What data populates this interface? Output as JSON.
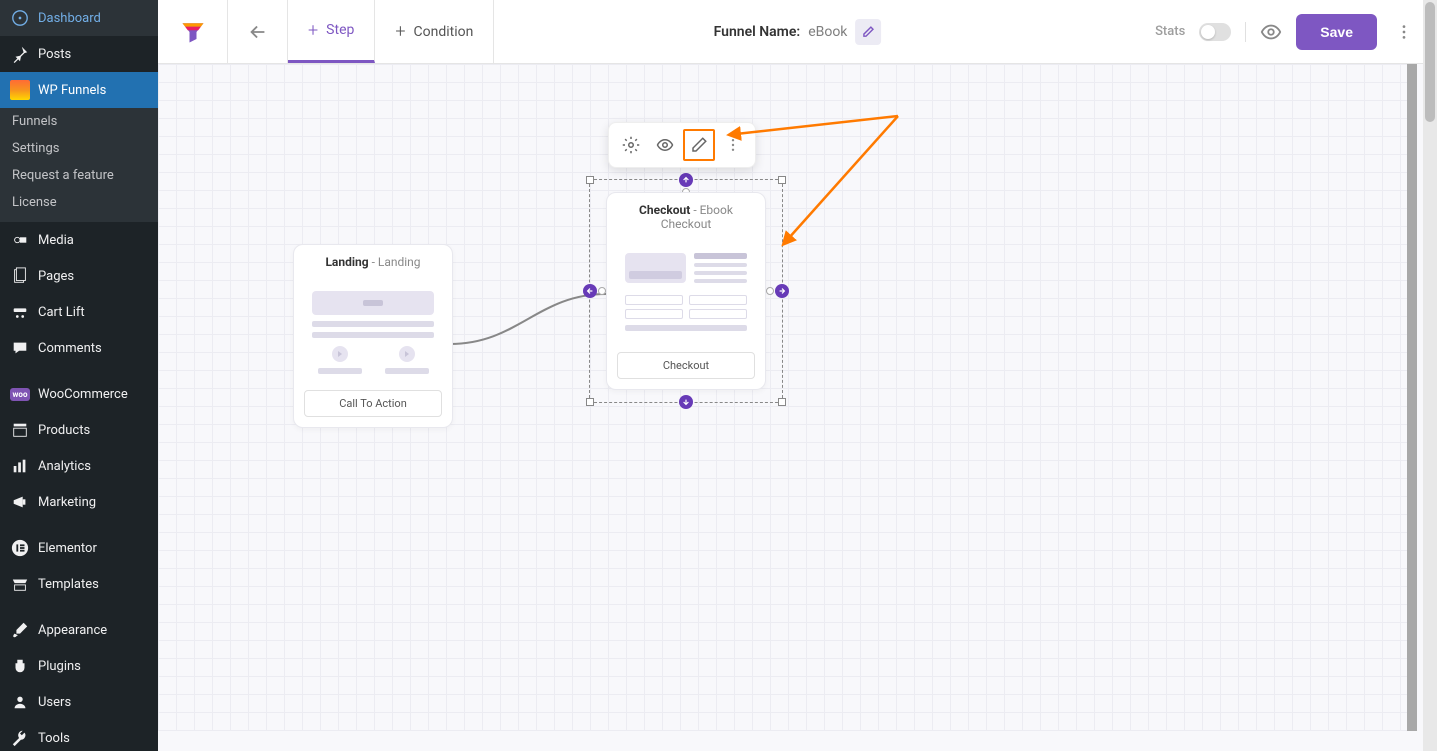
{
  "sidebar": {
    "items": [
      {
        "label": "Dashboard",
        "icon": "dashboard"
      },
      {
        "label": "Posts",
        "icon": "pin"
      },
      {
        "label": "WP Funnels",
        "icon": "wpf",
        "active": true
      },
      {
        "label": "Media",
        "icon": "media"
      },
      {
        "label": "Pages",
        "icon": "page"
      },
      {
        "label": "Cart Lift",
        "icon": "cart"
      },
      {
        "label": "Comments",
        "icon": "comment"
      },
      {
        "label": "WooCommerce",
        "icon": "woo"
      },
      {
        "label": "Products",
        "icon": "products"
      },
      {
        "label": "Analytics",
        "icon": "analytics"
      },
      {
        "label": "Marketing",
        "icon": "marketing"
      },
      {
        "label": "Elementor",
        "icon": "elementor"
      },
      {
        "label": "Templates",
        "icon": "templates"
      },
      {
        "label": "Appearance",
        "icon": "appearance"
      },
      {
        "label": "Plugins",
        "icon": "plugins"
      },
      {
        "label": "Users",
        "icon": "users"
      },
      {
        "label": "Tools",
        "icon": "tools"
      }
    ],
    "submenu": [
      "Funnels",
      "Settings",
      "Request a feature",
      "License"
    ]
  },
  "topbar": {
    "step_label": "Step",
    "condition_label": "Condition",
    "funnel_name_label": "Funnel Name:",
    "funnel_name_value": "eBook",
    "stats_label": "Stats",
    "save_label": "Save"
  },
  "cards": {
    "landing": {
      "type": "Landing",
      "title": "Landing",
      "cta": "Call To Action"
    },
    "checkout": {
      "type": "Checkout",
      "title": "Ebook Checkout",
      "cta": "Checkout"
    }
  },
  "colors": {
    "accent": "#7e57c2",
    "highlight": "#ff7a00"
  }
}
